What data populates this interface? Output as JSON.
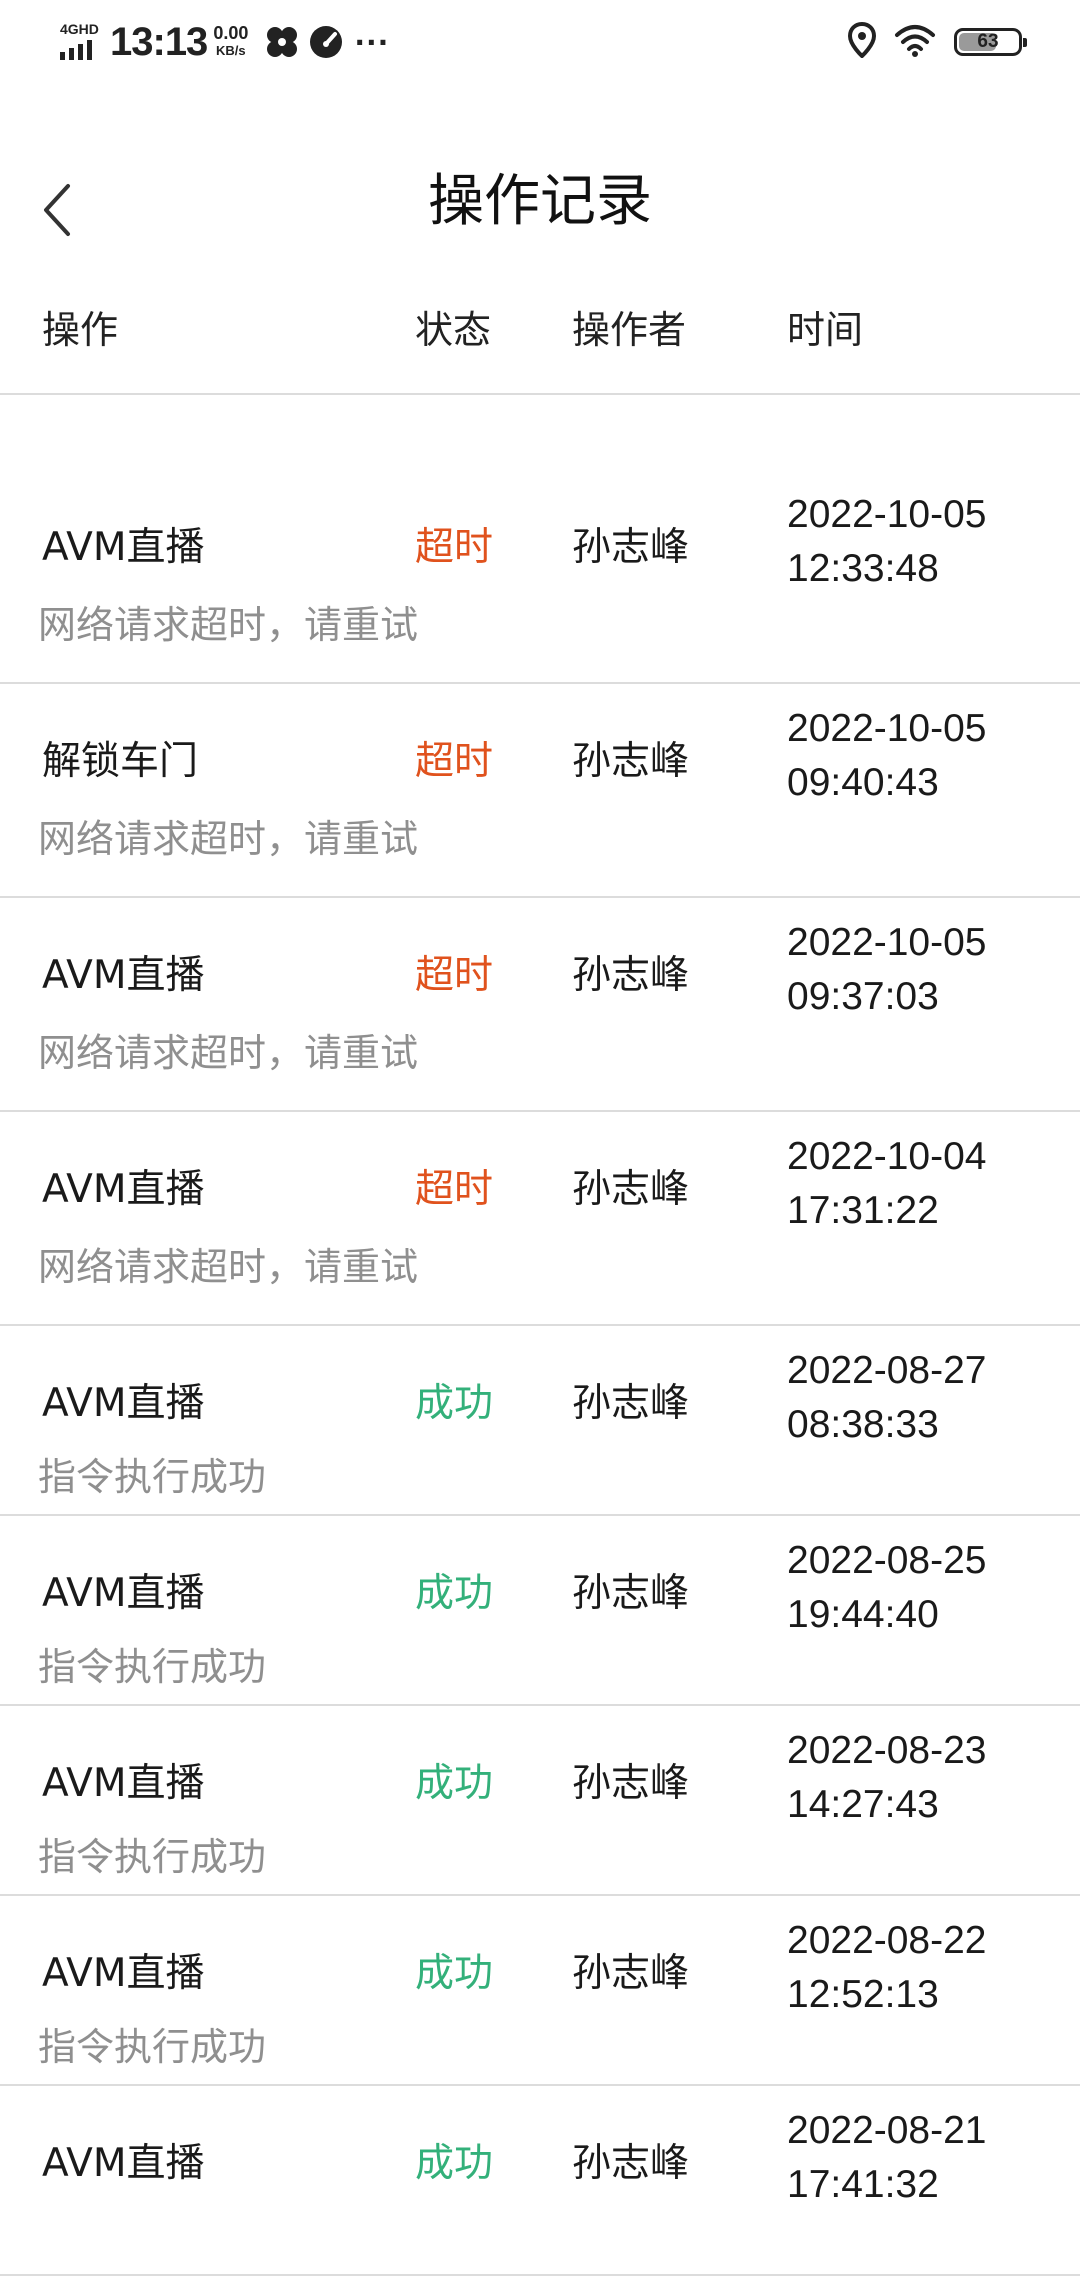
{
  "status_bar": {
    "network": "4GHD",
    "time": "13:13",
    "speed_value": "0.00",
    "speed_unit": "KB/s",
    "more": "···",
    "battery": "63",
    "battery_level_percent": 63,
    "icons": [
      "signal-icon",
      "fan-icon",
      "speedometer-icon",
      "location-icon",
      "wifi-icon",
      "battery-icon"
    ]
  },
  "nav": {
    "title": "操作记录",
    "back_icon": "chevron-left-icon"
  },
  "table": {
    "headers": {
      "operation": "操作",
      "status": "状态",
      "operator": "操作者",
      "time": "时间"
    },
    "rows": [
      {
        "operation": "AVM直播",
        "status": "超时",
        "status_type": "timeout",
        "operator": "孙志峰",
        "date": "2022-10-05",
        "clock": "12:33:48",
        "message": "网络请求超时，请重试"
      },
      {
        "operation": "解锁车门",
        "status": "超时",
        "status_type": "timeout",
        "operator": "孙志峰",
        "date": "2022-10-05",
        "clock": "09:40:43",
        "message": "网络请求超时，请重试"
      },
      {
        "operation": "AVM直播",
        "status": "超时",
        "status_type": "timeout",
        "operator": "孙志峰",
        "date": "2022-10-05",
        "clock": "09:37:03",
        "message": "网络请求超时，请重试"
      },
      {
        "operation": "AVM直播",
        "status": "超时",
        "status_type": "timeout",
        "operator": "孙志峰",
        "date": "2022-10-04",
        "clock": "17:31:22",
        "message": "网络请求超时，请重试"
      },
      {
        "operation": "AVM直播",
        "status": "成功",
        "status_type": "success",
        "operator": "孙志峰",
        "date": "2022-08-27",
        "clock": "08:38:33",
        "message": "指令执行成功"
      },
      {
        "operation": "AVM直播",
        "status": "成功",
        "status_type": "success",
        "operator": "孙志峰",
        "date": "2022-08-25",
        "clock": "19:44:40",
        "message": "指令执行成功"
      },
      {
        "operation": "AVM直播",
        "status": "成功",
        "status_type": "success",
        "operator": "孙志峰",
        "date": "2022-08-23",
        "clock": "14:27:43",
        "message": "指令执行成功"
      },
      {
        "operation": "AVM直播",
        "status": "成功",
        "status_type": "success",
        "operator": "孙志峰",
        "date": "2022-08-22",
        "clock": "12:52:13",
        "message": "指令执行成功"
      },
      {
        "operation": "AVM直播",
        "status": "成功",
        "status_type": "success",
        "operator": "孙志峰",
        "date": "2022-08-21",
        "clock": "17:41:32",
        "message": ""
      }
    ]
  },
  "colors": {
    "timeout": "#e0521d",
    "success": "#33b07a",
    "message": "#8f8f8f",
    "divider": "#dcdcdc"
  }
}
